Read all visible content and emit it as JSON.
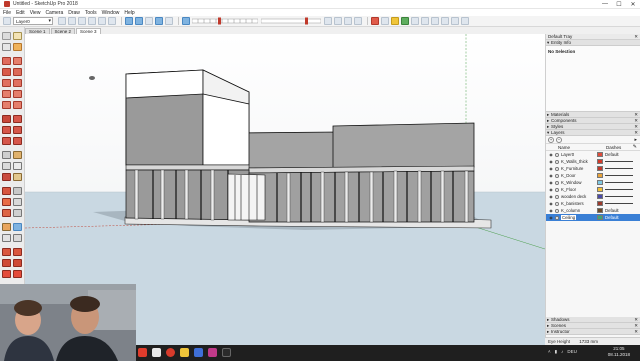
{
  "window": {
    "title": "Untitled - SketchUp Pro 2018",
    "controls": [
      "—",
      "☐",
      "✕"
    ]
  },
  "menu": [
    "File",
    "Edit",
    "View",
    "Camera",
    "Draw",
    "Tools",
    "Window",
    "Help"
  ],
  "toolbar": {
    "layer_select": "Layer0"
  },
  "scene_tabs": [
    {
      "label": "Scene 1",
      "active": false
    },
    {
      "label": "Scene 2",
      "active": false
    },
    {
      "label": "Scene 3",
      "active": true
    }
  ],
  "tray": {
    "title": "Default Tray",
    "entity_info": {
      "title": "Entity Info",
      "selection": "No Selection"
    },
    "collapsed_panels": [
      "Materials",
      "Components",
      "Styles"
    ],
    "layers": {
      "title": "Layers",
      "columns": {
        "name": "Name",
        "dashes": "Dashes"
      },
      "rows": [
        {
          "name": "Layer0",
          "color": "#e04b3a",
          "dashes": "Default",
          "selected": false
        },
        {
          "name": "K_Walls_thick",
          "color": "#d23a2a",
          "dashes": "",
          "selected": false
        },
        {
          "name": "K_Furniture",
          "color": "#c0392b",
          "dashes": "",
          "selected": false
        },
        {
          "name": "K_Door",
          "color": "#e8a33a",
          "dashes": "",
          "selected": false
        },
        {
          "name": "K_Window",
          "color": "#7ec8e3",
          "dashes": "",
          "selected": false
        },
        {
          "name": "K_Floor",
          "color": "#f2c037",
          "dashes": "",
          "selected": false
        },
        {
          "name": "wooden deck",
          "color": "#4b4aa8",
          "dashes": "",
          "selected": false
        },
        {
          "name": "K_banisters",
          "color": "#9b3a2c",
          "dashes": "",
          "selected": false
        },
        {
          "name": "K_column",
          "color": "#6b4a2a",
          "dashes": "Default",
          "selected": false
        },
        {
          "name": "Ceiling",
          "color": "#3aa57a",
          "dashes": "Default",
          "selected": true
        }
      ]
    },
    "bottom_panels": [
      "Shadows",
      "Scenes",
      "Instructor"
    ]
  },
  "status": {
    "eye_height_label": "Eye Height",
    "eye_height_value": "1733 mm",
    "time": "21:05",
    "date": "08.11.2018",
    "lang": "DEU"
  }
}
